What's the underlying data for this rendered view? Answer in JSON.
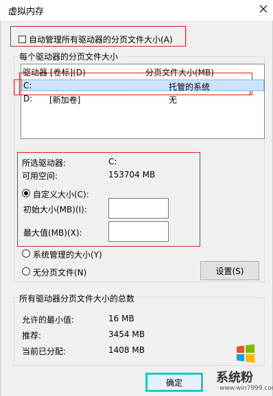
{
  "window": {
    "title": "虚拟内存"
  },
  "auto_manage": {
    "label": "自动管理所有驱动器的分页文件大小(A)",
    "checked": false
  },
  "per_drive_group": {
    "legend": "每个驱动器的分页文件大小",
    "columns": {
      "drive": "驱动器 [卷标](D)",
      "size": "分页文件大小(MB)"
    },
    "rows": [
      {
        "drive": "C:",
        "label": "",
        "size": "托管的系统",
        "selected": true
      },
      {
        "drive": "D:",
        "label": "[新加卷]",
        "size": "无",
        "selected": false
      }
    ],
    "selected_drive_label": "所选驱动器:",
    "selected_drive_value": "C:",
    "free_space_label": "可用空间:",
    "free_space_value": "153704 MB",
    "custom_size_label": "自定义大小(C):",
    "initial_size_label": "初始大小(MB)(I):",
    "initial_size_value": "",
    "max_size_label": "最大值(MB)(X):",
    "max_size_value": "",
    "system_managed_label": "系统管理的大小(Y)",
    "no_paging_label": "无分页文件(N)",
    "set_button": "设置(S)",
    "selected_option": "custom"
  },
  "total_group": {
    "legend": "所有驱动器分页文件大小的总数",
    "min_allowed_label": "允许的最小值:",
    "min_allowed_value": "16 MB",
    "recommended_label": "推荐:",
    "recommended_value": "3454 MB",
    "current_label": "当前已分配:",
    "current_value": "1408 MB"
  },
  "ok_button": "确定",
  "watermark": {
    "name": "系统粉",
    "url": "www.win7999.com"
  },
  "colors": {
    "highlight": "#e21c1c",
    "ok_border": "#1ec8c8",
    "selection": "#cce4f7"
  }
}
